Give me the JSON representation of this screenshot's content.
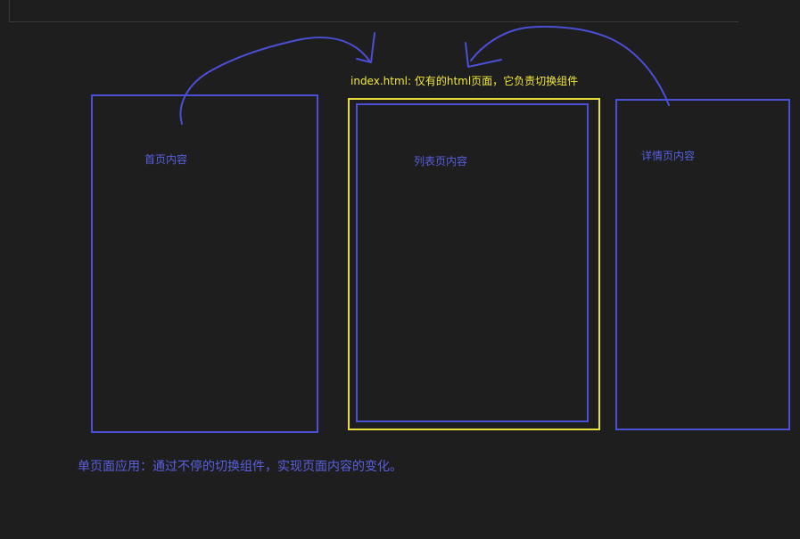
{
  "diagram": {
    "index_note": "index.html: 仅有的html页面，它负责切换组件",
    "components": {
      "home": "首页内容",
      "list": "列表页内容",
      "detail": "详情页内容"
    },
    "caption": "单页面应用：通过不停的切换组件，实现页面内容的变化。",
    "colors": {
      "background": "#1e1e1e",
      "component_border": "#4b4fd6",
      "index_border": "#e8de3a",
      "index_text": "#f2e83a",
      "label_text": "#5a5fe0"
    }
  }
}
